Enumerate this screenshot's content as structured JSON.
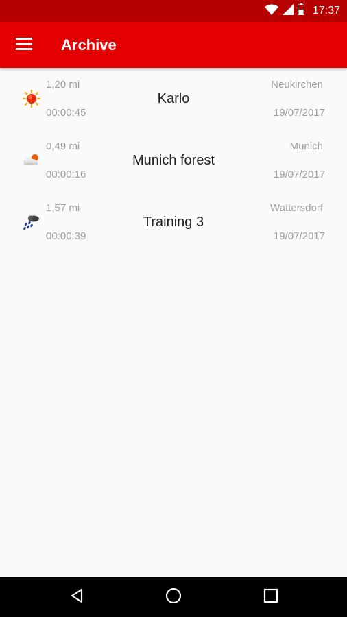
{
  "status_bar": {
    "time": "17:37",
    "icons": [
      "wifi-icon",
      "cell-signal-icon",
      "battery-icon"
    ]
  },
  "app_bar": {
    "title": "Archive",
    "menu_icon": "hamburger-menu-icon",
    "color": "#e50000"
  },
  "archive": {
    "items": [
      {
        "weather_icon": "sunny-icon",
        "distance": "1,20 mi",
        "duration": "00:00:45",
        "name": "Karlo",
        "location": "Neukirchen",
        "date": "19/07/2017"
      },
      {
        "weather_icon": "partly-cloudy-icon",
        "distance": "0,49 mi",
        "duration": "00:00:16",
        "name": "Munich forest",
        "location": "Munich",
        "date": "19/07/2017"
      },
      {
        "weather_icon": "rain-cloud-icon",
        "distance": "1,57 mi",
        "duration": "00:00:39",
        "name": "Training 3",
        "location": "Wattersdorf",
        "date": "19/07/2017"
      }
    ]
  },
  "nav_bar": {
    "buttons": [
      "back-icon",
      "home-icon",
      "recents-icon"
    ]
  }
}
